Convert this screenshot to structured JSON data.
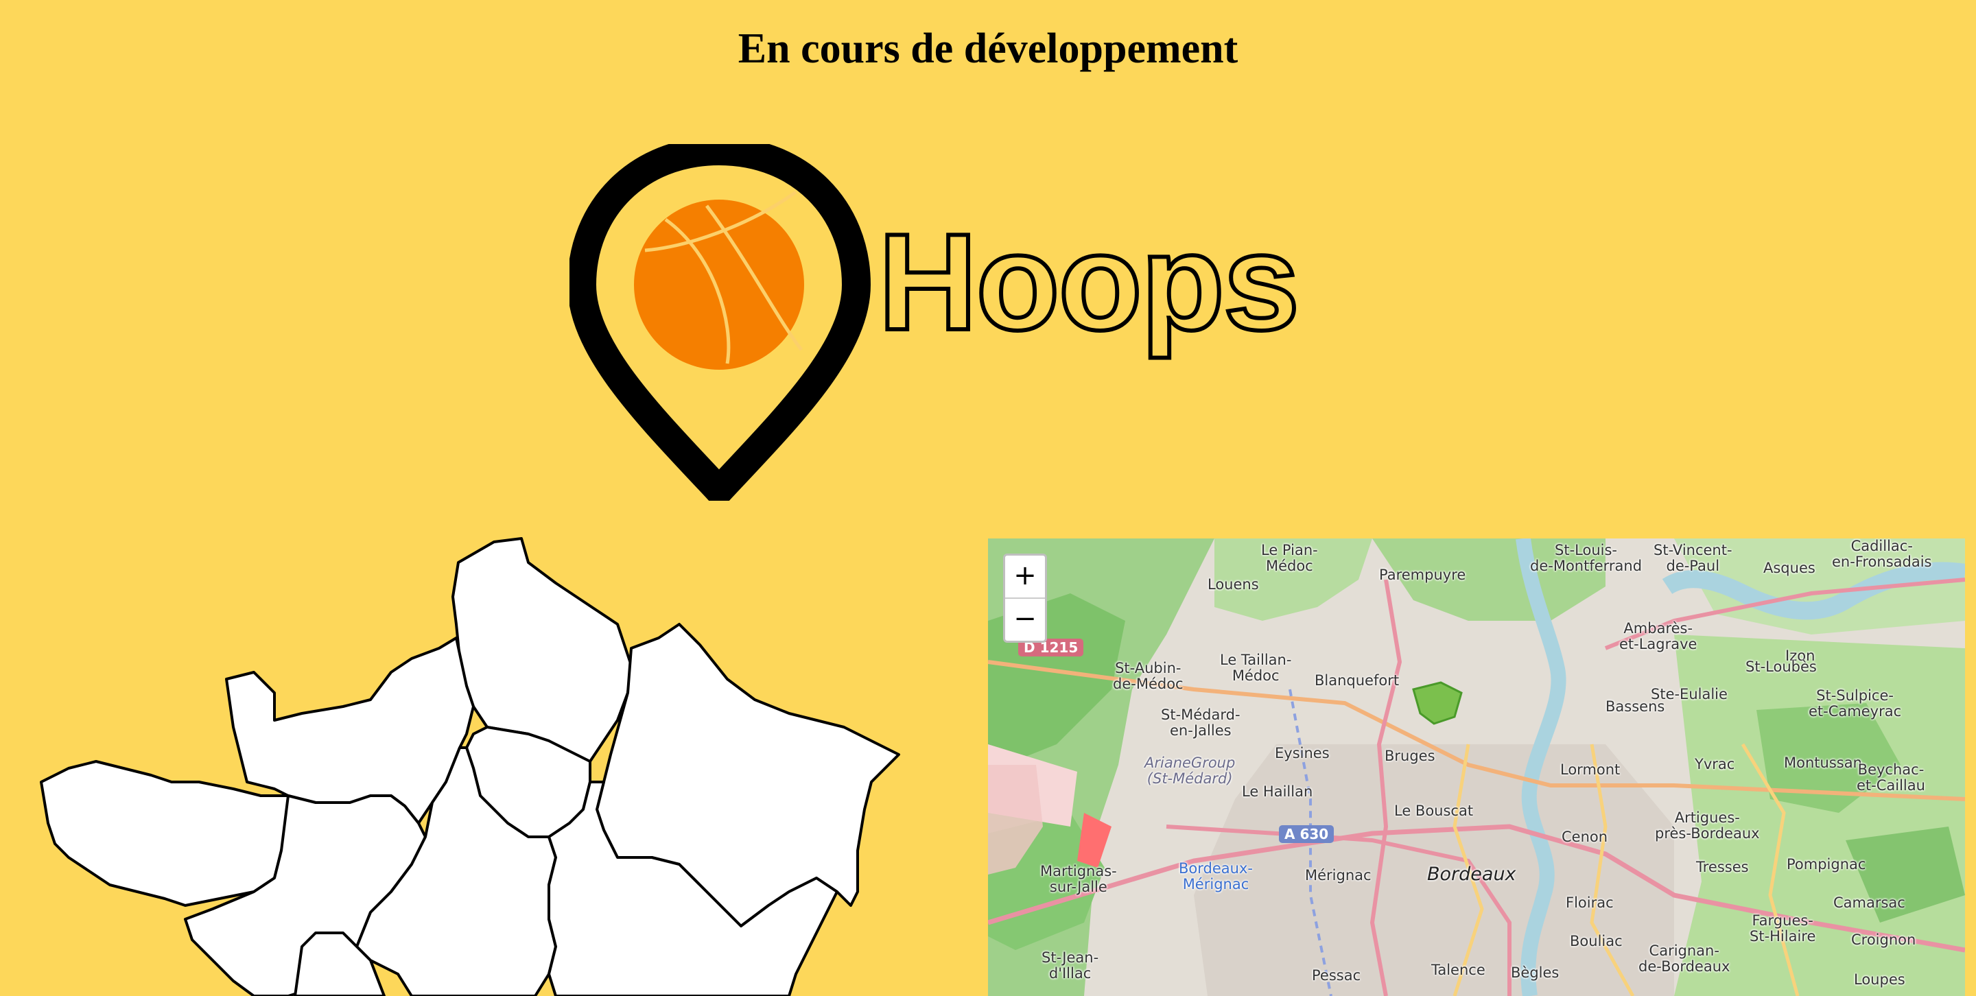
{
  "page": {
    "title": "En cours de développement",
    "background": "#fdd75a"
  },
  "logo": {
    "text": "Hoops",
    "pin_color": "#000000",
    "ball_color": "#f57f00",
    "icon": "map-pin-basketball-icon"
  },
  "region_map": {
    "fill": "#ffffff",
    "stroke": "#000000"
  },
  "map": {
    "zoom_in_label": "+",
    "zoom_out_label": "−",
    "roads": [
      "D 1215",
      "A 630"
    ],
    "places": [
      {
        "name": "Le Pian-\nMédoc"
      },
      {
        "name": "Louens"
      },
      {
        "name": "Parempuyre"
      },
      {
        "name": "St-Louis-\nde-Montferrand"
      },
      {
        "name": "St-Vincent-\nde-Paul"
      },
      {
        "name": "Cadillac-\nen-Fronsadais"
      },
      {
        "name": "Asques"
      },
      {
        "name": "St-Aubin-\nde-Médoc"
      },
      {
        "name": "Le Taillan-\nMédoc"
      },
      {
        "name": "Blanquefort"
      },
      {
        "name": "Ambarès-\net-Lagrave"
      },
      {
        "name": "Izon"
      },
      {
        "name": "St-Loubès"
      },
      {
        "name": "St-Médard-\nen-Jalles"
      },
      {
        "name": "Bassens"
      },
      {
        "name": "Ste-Eulalie"
      },
      {
        "name": "St-Sulpice-\net-Cameyrac"
      },
      {
        "name": "ArianeGroup\n(St-Médard)"
      },
      {
        "name": "Eysines"
      },
      {
        "name": "Bruges"
      },
      {
        "name": "Lormont"
      },
      {
        "name": "Yvrac"
      },
      {
        "name": "Montussan"
      },
      {
        "name": "Le Haillan"
      },
      {
        "name": "Le Bouscat"
      },
      {
        "name": "Beychac-\net-Caillau"
      },
      {
        "name": "Cenon"
      },
      {
        "name": "Artigues-\nprès-Bordeaux"
      },
      {
        "name": "Martignas-\nsur-Jalle"
      },
      {
        "name": "Bordeaux-\nMérignac"
      },
      {
        "name": "Mérignac"
      },
      {
        "name": "Bordeaux"
      },
      {
        "name": "Tresses"
      },
      {
        "name": "Pompignac"
      },
      {
        "name": "Floirac"
      },
      {
        "name": "Camarsac"
      },
      {
        "name": "Fargues-\nSt-Hilaire"
      },
      {
        "name": "St-Jean-\nd'Illac"
      },
      {
        "name": "Bouliac"
      },
      {
        "name": "Carignan-\nde-Bordeaux"
      },
      {
        "name": "Croignon"
      },
      {
        "name": "Pessac"
      },
      {
        "name": "Talence"
      },
      {
        "name": "Bègles"
      },
      {
        "name": "Loupes"
      }
    ]
  }
}
